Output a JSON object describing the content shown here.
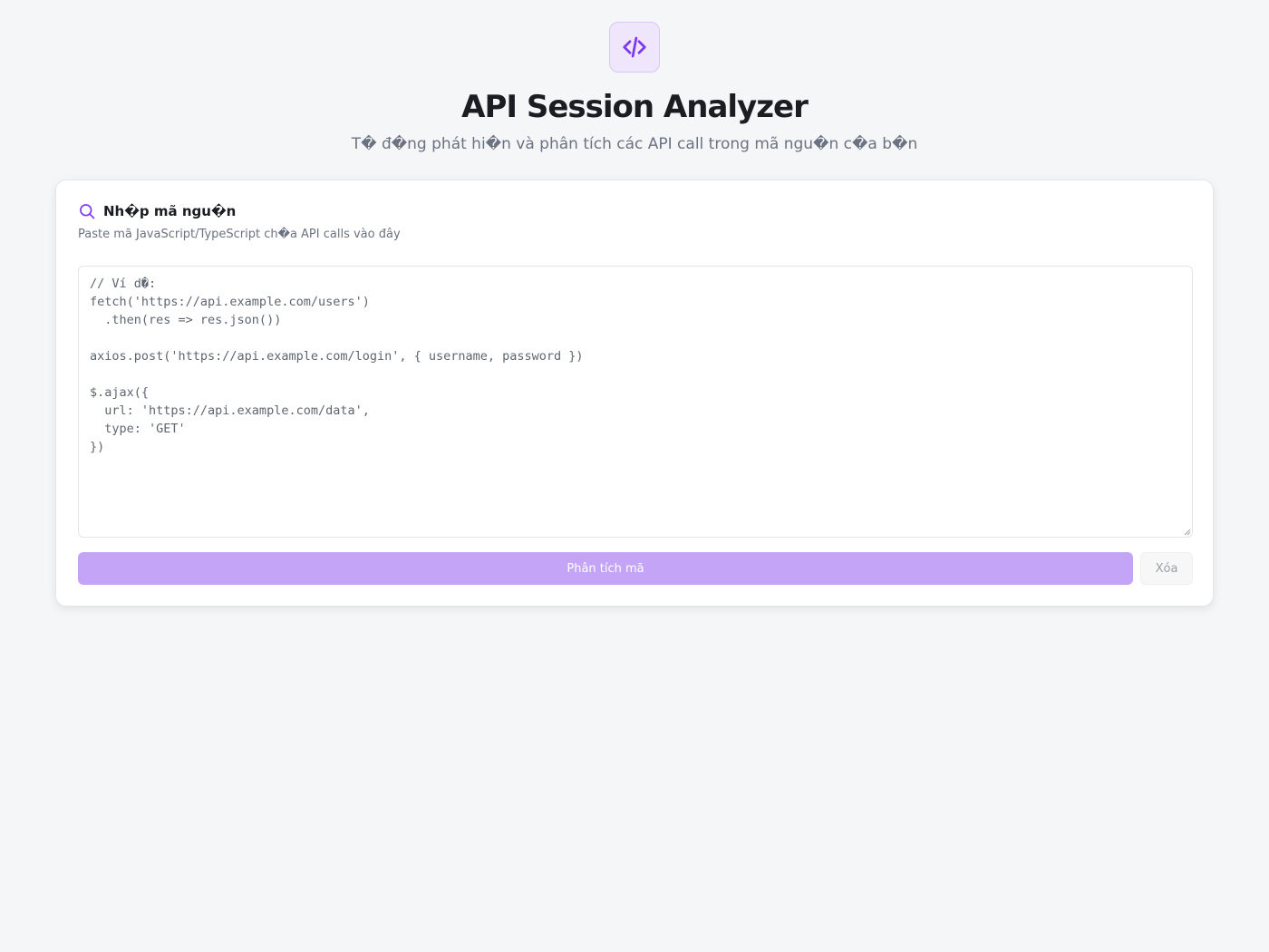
{
  "header": {
    "logo_icon": "code-icon",
    "title": "API Session Analyzer",
    "subtitle": "T� đ�ng phát hi�n và phân tích các API call trong mã ngu�n c�a b�n"
  },
  "input_card": {
    "icon": "search-icon",
    "title": "Nh�p mã ngu�n",
    "description": "Paste mã JavaScript/TypeScript ch�a API calls vào đây",
    "code_placeholder": "// Ví d�:\nfetch('https://api.example.com/users')\n  .then(res => res.json())\n\naxios.post('https://api.example.com/login', { username, password })\n\n$.ajax({\n  url: 'https://api.example.com/data',\n  type: 'GET'\n})",
    "analyze_label": "Phân tích mã",
    "clear_label": "Xóa"
  },
  "colors": {
    "accent": "#7c3aed",
    "button": "#c4a4f7",
    "background": "#f5f6f8"
  }
}
